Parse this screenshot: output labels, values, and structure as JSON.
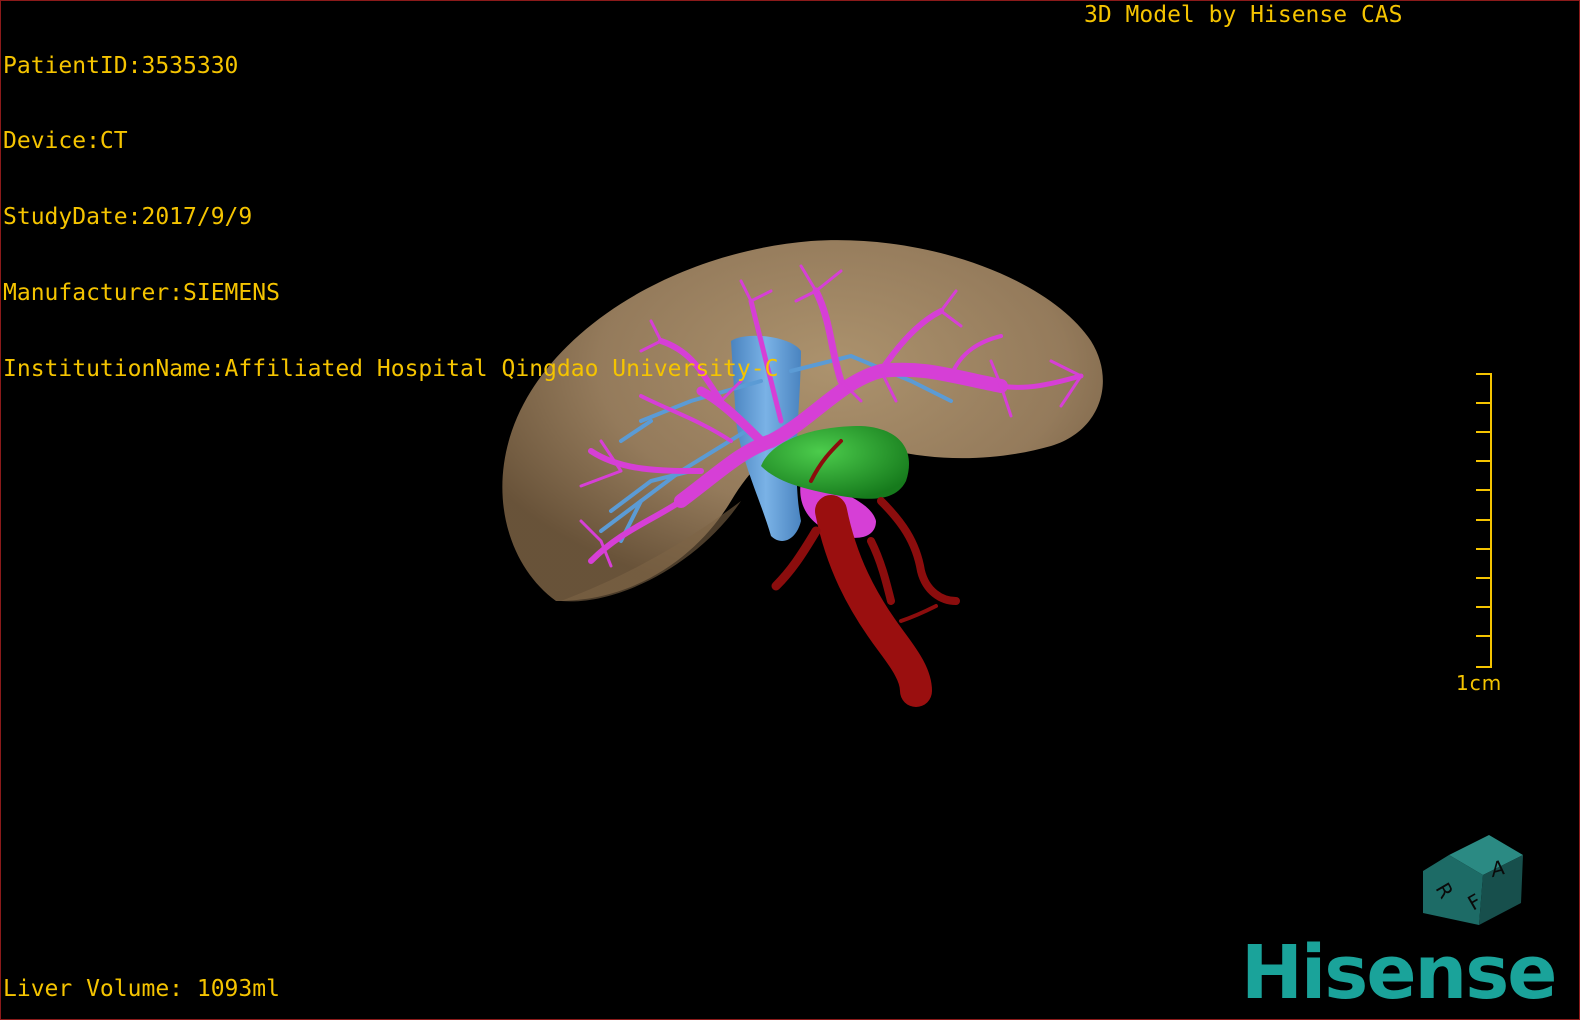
{
  "header": {
    "patient_id": "PatientID:3535330",
    "device": "Device:CT",
    "study_date": "StudyDate:2017/9/9",
    "manufacturer": "Manufacturer:SIEMENS",
    "institution": "InstitutionName:Affiliated Hospital Qingdao University-C",
    "model_by": "3D Model by Hisense CAS"
  },
  "footer": {
    "liver_volume": "Liver Volume: 1093ml"
  },
  "scale": {
    "label": "1cm"
  },
  "orientation_cube": {
    "faces": [
      "A",
      "R",
      "F"
    ],
    "color": "#1d6b66"
  },
  "logo": {
    "text": "Hisense",
    "color": "#1aa39a"
  },
  "colors": {
    "text": "#f5c400",
    "liver": "#9e8360",
    "portal_vein": "#d63fd6",
    "hepatic_vein": "#5b9bd5",
    "gallbladder": "#22a32a",
    "artery": "#9a0f0f"
  }
}
